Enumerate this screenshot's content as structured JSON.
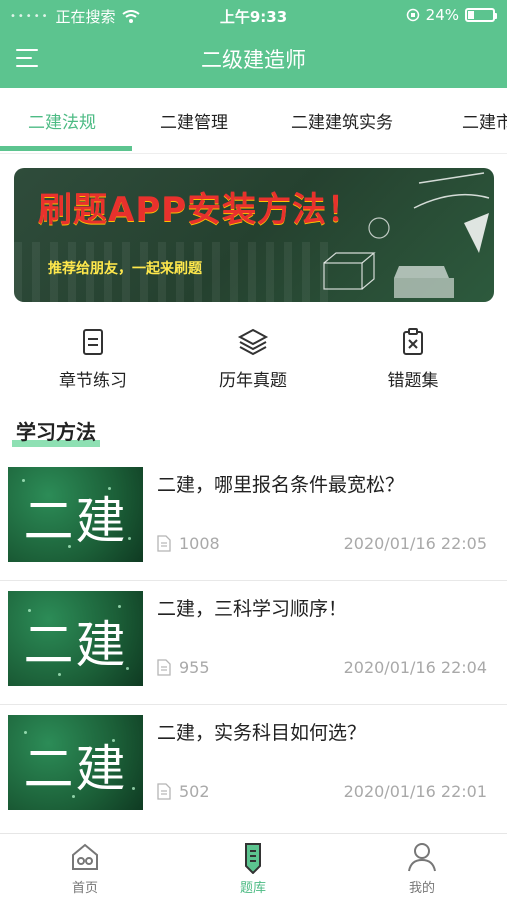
{
  "status": {
    "carrier": "正在搜索",
    "time": "上午9:33",
    "battery": "24%"
  },
  "nav": {
    "title": "二级建造师"
  },
  "tabs": [
    {
      "label": "二建法规"
    },
    {
      "label": "二建管理"
    },
    {
      "label": "二建建筑实务"
    },
    {
      "label": "二建市"
    }
  ],
  "banner": {
    "title": "刷题APP安装方法！",
    "subtitle": "推荐给朋友，一起来刷题"
  },
  "categories": [
    {
      "label": "章节练习",
      "icon": "chapter-practice-icon"
    },
    {
      "label": "历年真题",
      "icon": "past-exams-layers-icon"
    },
    {
      "label": "错题集",
      "icon": "wrong-questions-clipboard-icon"
    }
  ],
  "section": {
    "title": "学习方法"
  },
  "articles": [
    {
      "thumb_text": "二建",
      "title": "二建，哪里报名条件最宽松？",
      "views": "1008",
      "date": "2020/01/16 22:05"
    },
    {
      "thumb_text": "二建",
      "title": "二建，三科学习顺序！",
      "views": "955",
      "date": "2020/01/16 22:04"
    },
    {
      "thumb_text": "二建",
      "title": "二建，实务科目如何选？",
      "views": "502",
      "date": "2020/01/16 22:01"
    }
  ],
  "tabbar": [
    {
      "label": "首页",
      "icon": "home-icon"
    },
    {
      "label": "题库",
      "icon": "question-bank-pen-icon"
    },
    {
      "label": "我的",
      "icon": "profile-icon"
    }
  ],
  "colors": {
    "primary": "#5cc48f",
    "accent": "#4dbb84",
    "banner_title": "#e8312d",
    "banner_sub": "#ffe84c"
  },
  "progress": {
    "battery_fraction": 0.24
  }
}
